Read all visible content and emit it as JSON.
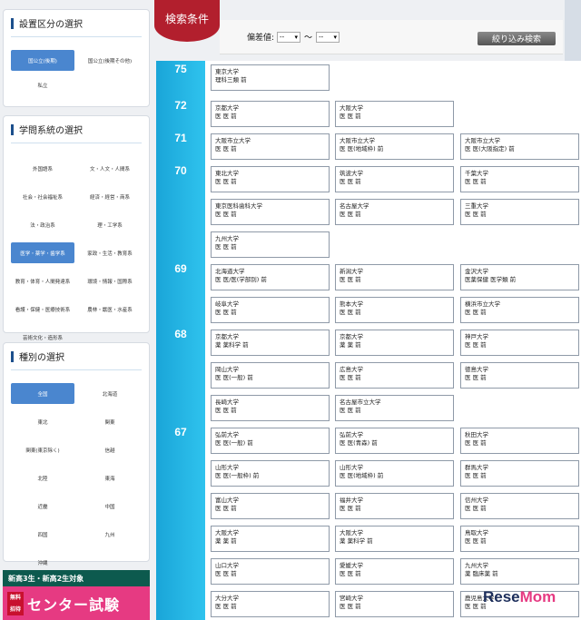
{
  "sidebar": {
    "establishment": {
      "title": "設置区分の選択",
      "options": [
        {
          "label": "国公立(後期)",
          "selected": true
        },
        {
          "label": "国公立(後期その他)",
          "selected": false
        },
        {
          "label": "私立",
          "selected": false
        }
      ]
    },
    "fields": {
      "title": "学問系統の選択",
      "options": [
        {
          "label": "外国語系",
          "selected": false
        },
        {
          "label": "文・人文・人間系",
          "selected": false
        },
        {
          "label": "社会・社会福祉系",
          "selected": false
        },
        {
          "label": "経済・経営・商系",
          "selected": false
        },
        {
          "label": "法・政治系",
          "selected": false
        },
        {
          "label": "理・工学系",
          "selected": false
        },
        {
          "label": "医学・薬学・歯学系",
          "selected": true
        },
        {
          "label": "家政・生活・教育系",
          "selected": false
        },
        {
          "label": "教育・体育・人間発達系",
          "selected": false
        },
        {
          "label": "環境・情報・国際系",
          "selected": false
        },
        {
          "label": "看護・保健・医療技術系",
          "selected": false
        },
        {
          "label": "農林・獣医・水産系",
          "selected": false
        },
        {
          "label": "芸術文化・造形系",
          "selected": false
        }
      ]
    },
    "types": {
      "title": "種別の選択",
      "options": [
        {
          "label": "全国",
          "selected": true
        },
        {
          "label": "北海道",
          "selected": false
        },
        {
          "label": "東北",
          "selected": false
        },
        {
          "label": "関東",
          "selected": false
        },
        {
          "label": "関東(東京除く)",
          "selected": false
        },
        {
          "label": "信越",
          "selected": false
        },
        {
          "label": "北陸",
          "selected": false
        },
        {
          "label": "東海",
          "selected": false
        },
        {
          "label": "近畿",
          "selected": false
        },
        {
          "label": "中国",
          "selected": false
        },
        {
          "label": "四国",
          "selected": false
        },
        {
          "label": "九州",
          "selected": false
        },
        {
          "label": "沖縄",
          "selected": false
        }
      ]
    },
    "banner": {
      "top": "新高3生・新高2生対象",
      "badge_1": "無料",
      "badge_2": "招待",
      "main": "センター試験"
    }
  },
  "header": {
    "tab_label": "検索条件",
    "deviation_label": "偏差値:",
    "min_value": "--",
    "max_value": "--",
    "tilde": "〜",
    "filter_button": "絞り込み検索"
  },
  "results": [
    {
      "value": "75",
      "cards": [
        {
          "name": "東京大学",
          "dept": "理科三類 前"
        }
      ]
    },
    {
      "value": "72",
      "cards": [
        {
          "name": "京都大学",
          "dept": "医 医 前"
        },
        {
          "name": "大阪大学",
          "dept": "医 医 前"
        }
      ]
    },
    {
      "value": "71",
      "cards": [
        {
          "name": "大阪市立大学",
          "dept": "医 医 前"
        },
        {
          "name": "大阪市立大学",
          "dept": "医 医(地域枠) 前"
        },
        {
          "name": "大阪市立大学",
          "dept": "医 医(大阪指定) 前"
        }
      ]
    },
    {
      "value": "70",
      "cards": [
        {
          "name": "東北大学",
          "dept": "医 医 前"
        },
        {
          "name": "筑波大学",
          "dept": "医 医 前"
        },
        {
          "name": "千葉大学",
          "dept": "医 医 前"
        },
        {
          "name": "東京医科歯科大学",
          "dept": "医 医 前"
        },
        {
          "name": "名古屋大学",
          "dept": "医 医 前"
        },
        {
          "name": "三重大学",
          "dept": "医 医 前"
        },
        {
          "name": "九州大学",
          "dept": "医 医 前"
        }
      ]
    },
    {
      "value": "69",
      "cards": [
        {
          "name": "北海道大学",
          "dept": "医 医/医(学部別) 前"
        },
        {
          "name": "新潟大学",
          "dept": "医 医 前"
        },
        {
          "name": "金沢大学",
          "dept": "医薬保健 医学類 前"
        },
        {
          "name": "岐阜大学",
          "dept": "医 医 前"
        },
        {
          "name": "熊本大学",
          "dept": "医 医 前"
        },
        {
          "name": "横浜市立大学",
          "dept": "医 医 前"
        }
      ]
    },
    {
      "value": "68",
      "cards": [
        {
          "name": "京都大学",
          "dept": "薬 薬科学 前"
        },
        {
          "name": "京都大学",
          "dept": "薬 薬 前"
        },
        {
          "name": "神戸大学",
          "dept": "医 医 前"
        },
        {
          "name": "岡山大学",
          "dept": "医 医(一般) 前"
        },
        {
          "name": "広島大学",
          "dept": "医 医 前"
        },
        {
          "name": "徳島大学",
          "dept": "医 医 前"
        },
        {
          "name": "長崎大学",
          "dept": "医 医 前"
        },
        {
          "name": "名古屋市立大学",
          "dept": "医 医 前"
        }
      ]
    },
    {
      "value": "67",
      "cards": [
        {
          "name": "弘前大学",
          "dept": "医 医(一般) 前"
        },
        {
          "name": "弘前大学",
          "dept": "医 医(青森) 前"
        },
        {
          "name": "秋田大学",
          "dept": "医 医 前"
        },
        {
          "name": "山形大学",
          "dept": "医 医(一般枠) 前"
        },
        {
          "name": "山形大学",
          "dept": "医 医(地域枠) 前"
        },
        {
          "name": "群馬大学",
          "dept": "医 医 前"
        },
        {
          "name": "富山大学",
          "dept": "医 医 前"
        },
        {
          "name": "福井大学",
          "dept": "医 医 前"
        },
        {
          "name": "信州大学",
          "dept": "医 医 前"
        },
        {
          "name": "大阪大学",
          "dept": "薬 薬 前"
        },
        {
          "name": "大阪大学",
          "dept": "薬 薬科学 前"
        },
        {
          "name": "鳥取大学",
          "dept": "医 医 前"
        },
        {
          "name": "山口大学",
          "dept": "医 医 前"
        },
        {
          "name": "愛媛大学",
          "dept": "医 医 前"
        },
        {
          "name": "九州大学",
          "dept": "薬 臨床薬 前"
        },
        {
          "name": "大分大学",
          "dept": "医 医 前"
        },
        {
          "name": "宮崎大学",
          "dept": "医 医 前"
        },
        {
          "name": "鹿児島大学",
          "dept": "医 医 前"
        }
      ]
    }
  ],
  "watermark": {
    "part1": "Rese",
    "part2": "Mom"
  }
}
